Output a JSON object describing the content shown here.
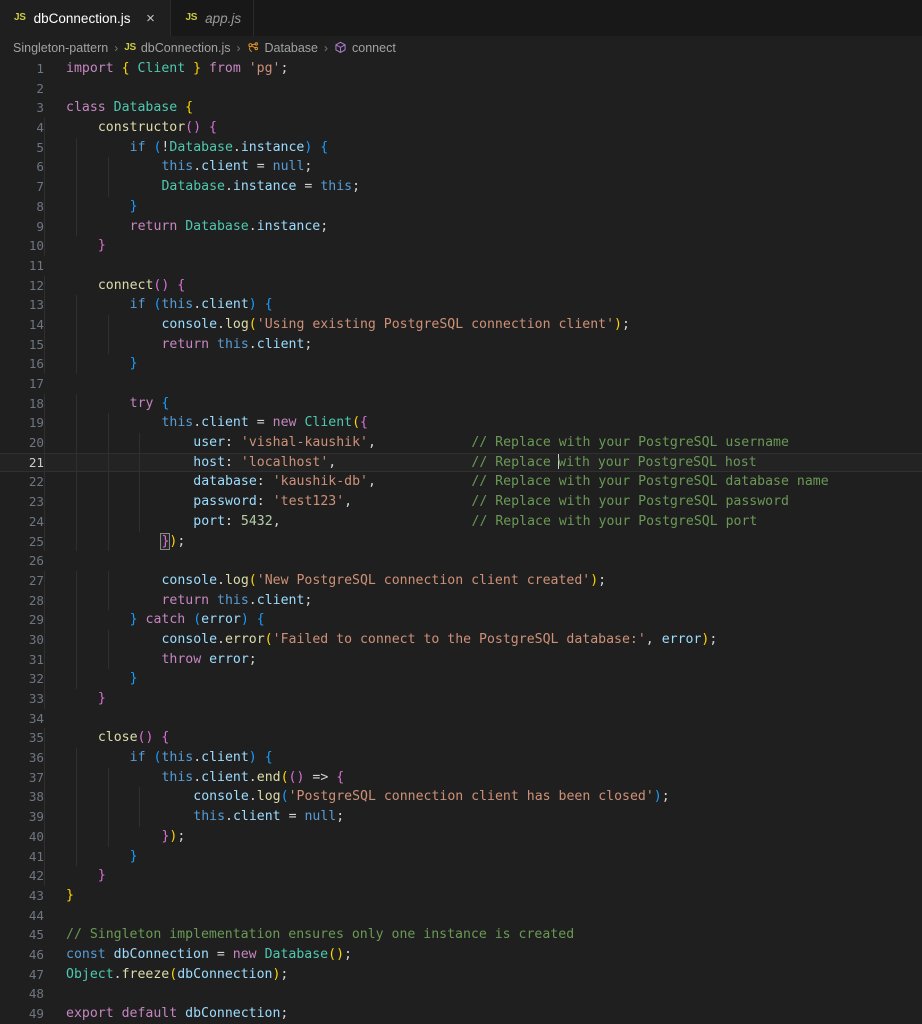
{
  "window": {
    "editor_bg": "#1f1f1f",
    "tabbar_bg": "#181818",
    "accent": "#cbcb41"
  },
  "tabs": [
    {
      "icon": "js-file-icon",
      "icon_label": "JS",
      "label": "dbConnection.js",
      "active": true,
      "close_label": "×"
    },
    {
      "icon": "js-file-icon",
      "icon_label": "JS",
      "label": "app.js",
      "active": false,
      "close_label": ""
    }
  ],
  "breadcrumb": {
    "separator": "›",
    "items": [
      {
        "label": "Singleton-pattern",
        "icon": ""
      },
      {
        "label": "dbConnection.js",
        "icon": "js-file-icon",
        "icon_label": "JS"
      },
      {
        "label": "Database",
        "icon": "class-symbol-icon"
      },
      {
        "label": "connect",
        "icon": "method-symbol-icon"
      }
    ]
  },
  "editor": {
    "language": "javascript",
    "current_line": 21,
    "cursor": {
      "line": 21,
      "column": 50
    },
    "first_line": 1,
    "last_line": 49,
    "lines": [
      {
        "n": 1,
        "text": "import { Client } from 'pg';"
      },
      {
        "n": 2,
        "text": ""
      },
      {
        "n": 3,
        "text": "class Database {"
      },
      {
        "n": 4,
        "text": "    constructor() {"
      },
      {
        "n": 5,
        "text": "        if (!Database.instance) {"
      },
      {
        "n": 6,
        "text": "            this.client = null;"
      },
      {
        "n": 7,
        "text": "            Database.instance = this;"
      },
      {
        "n": 8,
        "text": "        }"
      },
      {
        "n": 9,
        "text": "        return Database.instance;"
      },
      {
        "n": 10,
        "text": "    }"
      },
      {
        "n": 11,
        "text": ""
      },
      {
        "n": 12,
        "text": "    connect() {"
      },
      {
        "n": 13,
        "text": "        if (this.client) {"
      },
      {
        "n": 14,
        "text": "            console.log('Using existing PostgreSQL connection client');"
      },
      {
        "n": 15,
        "text": "            return this.client;"
      },
      {
        "n": 16,
        "text": "        }"
      },
      {
        "n": 17,
        "text": ""
      },
      {
        "n": 18,
        "text": "        try {"
      },
      {
        "n": 19,
        "text": "            this.client = new Client({"
      },
      {
        "n": 20,
        "text": "                user: 'vishal-kaushik',            // Replace with your PostgreSQL username"
      },
      {
        "n": 21,
        "text": "                host: 'localhost',                 // Replace with your PostgreSQL host"
      },
      {
        "n": 22,
        "text": "                database: 'kaushik-db',            // Replace with your PostgreSQL database name"
      },
      {
        "n": 23,
        "text": "                password: 'test123',               // Replace with your PostgreSQL password"
      },
      {
        "n": 24,
        "text": "                port: 5432,                        // Replace with your PostgreSQL port"
      },
      {
        "n": 25,
        "text": "            });"
      },
      {
        "n": 26,
        "text": ""
      },
      {
        "n": 27,
        "text": "            console.log('New PostgreSQL connection client created');"
      },
      {
        "n": 28,
        "text": "            return this.client;"
      },
      {
        "n": 29,
        "text": "        } catch (error) {"
      },
      {
        "n": 30,
        "text": "            console.error('Failed to connect to the PostgreSQL database:', error);"
      },
      {
        "n": 31,
        "text": "            throw error;"
      },
      {
        "n": 32,
        "text": "        }"
      },
      {
        "n": 33,
        "text": "    }"
      },
      {
        "n": 34,
        "text": ""
      },
      {
        "n": 35,
        "text": "    close() {"
      },
      {
        "n": 36,
        "text": "        if (this.client) {"
      },
      {
        "n": 37,
        "text": "            this.client.end(() => {"
      },
      {
        "n": 38,
        "text": "                console.log('PostgreSQL connection client has been closed');"
      },
      {
        "n": 39,
        "text": "                this.client = null;"
      },
      {
        "n": 40,
        "text": "            });"
      },
      {
        "n": 41,
        "text": "        }"
      },
      {
        "n": 42,
        "text": "    }"
      },
      {
        "n": 43,
        "text": "}"
      },
      {
        "n": 44,
        "text": ""
      },
      {
        "n": 45,
        "text": "// Singleton implementation ensures only one instance is created"
      },
      {
        "n": 46,
        "text": "const dbConnection = new Database();"
      },
      {
        "n": 47,
        "text": "Object.freeze(dbConnection);"
      },
      {
        "n": 48,
        "text": ""
      },
      {
        "n": 49,
        "text": "export default dbConnection;"
      }
    ],
    "comments": [
      "// Replace with your PostgreSQL username",
      "// Replace with your PostgreSQL host",
      "// Replace with your PostgreSQL database name",
      "// Replace with your PostgreSQL password",
      "// Replace with your PostgreSQL port",
      "// Singleton implementation ensures only one instance is created"
    ],
    "strings": [
      "'pg'",
      "'Using existing PostgreSQL connection client'",
      "'vishal-kaushik'",
      "'localhost'",
      "'kaushik-db'",
      "'test123'",
      "'New PostgreSQL connection client created'",
      "'Failed to connect to the PostgreSQL database:'",
      "'PostgreSQL connection client has been closed'"
    ],
    "numbers": [
      "5432"
    ],
    "colors": {
      "keyword": "#c586c0",
      "keyword_blue": "#569cd6",
      "class": "#4ec9b0",
      "function": "#dcdcaa",
      "variable": "#9cdcfe",
      "string": "#ce9178",
      "number": "#b5cea8",
      "comment": "#6a9955",
      "operator": "#d4d4d4",
      "bracket1": "#ffd700",
      "bracket2": "#da70d6",
      "bracket3": "#179fff",
      "line_number": "#6e7681",
      "line_number_active": "#cccccc",
      "current_line_bg": "#232323"
    }
  }
}
